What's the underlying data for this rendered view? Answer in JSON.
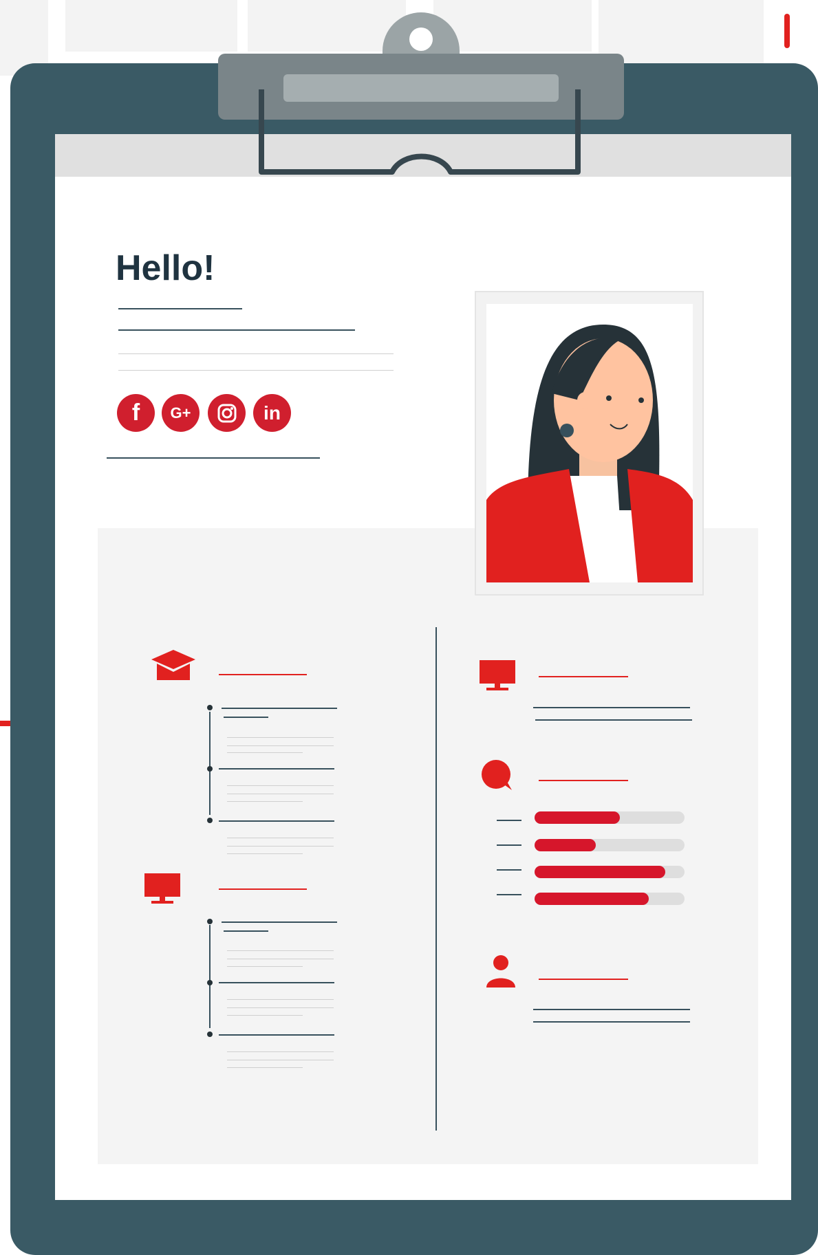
{
  "greeting": "Hello!",
  "social": [
    {
      "name": "facebook",
      "glyph": "f"
    },
    {
      "name": "google-plus",
      "glyph": "G+"
    },
    {
      "name": "instagram",
      "glyph": ""
    },
    {
      "name": "linkedin",
      "glyph": "in"
    }
  ],
  "skills": [
    {
      "level": 0.57
    },
    {
      "level": 0.41
    },
    {
      "level": 0.87
    },
    {
      "level": 0.76
    }
  ],
  "colors": {
    "board": "#3a5a65",
    "accent": "#d6162b",
    "paper": "#ffffff",
    "panel": "#f4f4f4",
    "ink": "#263238"
  },
  "icons": [
    "graduation-cap-icon",
    "monitor-icon",
    "chat-bubble-icon",
    "user-icon"
  ]
}
